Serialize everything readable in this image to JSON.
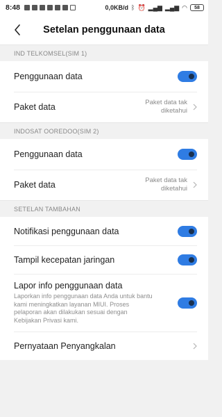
{
  "status_bar": {
    "time": "8:48",
    "network_speed": "0,0KB/d",
    "battery": "58"
  },
  "header": {
    "title": "Setelan penggunaan data"
  },
  "sections": [
    {
      "title": "IND TELKOMSEL(SIM 1)",
      "rows": [
        {
          "label": "Penggunaan data",
          "type": "toggle",
          "on": true
        },
        {
          "label": "Paket data",
          "type": "link",
          "value": "Paket data tak diketahui"
        }
      ]
    },
    {
      "title": "INDOSAT OOREDOO(SIM 2)",
      "rows": [
        {
          "label": "Penggunaan data",
          "type": "toggle",
          "on": true
        },
        {
          "label": "Paket data",
          "type": "link",
          "value": "Paket data tak diketahui"
        }
      ]
    },
    {
      "title": "SETELAN TAMBAHAN",
      "rows": [
        {
          "label": "Notifikasi penggunaan data",
          "type": "toggle",
          "on": true
        },
        {
          "label": "Tampil kecepatan jaringan",
          "type": "toggle",
          "on": true
        },
        {
          "label": "Lapor info penggunaan data",
          "type": "toggle",
          "on": true,
          "description": "Laporkan info penggunaan data Anda untuk bantu kami meningkatkan layanan MIUI. Proses pelaporan akan dilakukan sesuai dengan Kebijakan Privasi kami."
        },
        {
          "label": "Pernyataan Penyangkalan",
          "type": "link"
        }
      ]
    }
  ],
  "colors": {
    "accent": "#2f7ce3",
    "background": "#f1f1f1"
  },
  "icons": [
    "back-arrow-icon",
    "chevron-right-icon"
  ]
}
